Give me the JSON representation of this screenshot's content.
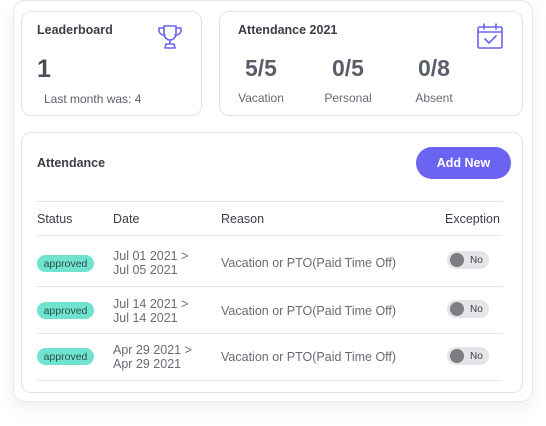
{
  "leaderboard": {
    "title": "Leaderboard",
    "icon": "trophy-icon",
    "rank": "1",
    "last_month": "Last month was: 4"
  },
  "attendance_summary": {
    "title": "Attendance 2021",
    "icon": "calendar-check-icon",
    "stats": [
      {
        "value": "5/5",
        "label": "Vacation"
      },
      {
        "value": "0/5",
        "label": "Personal"
      },
      {
        "value": "0/8",
        "label": "Absent"
      }
    ]
  },
  "attendance_table": {
    "title": "Attendance",
    "add_button": "Add New",
    "columns": [
      "Status",
      "Date",
      "Reason",
      "Exception"
    ],
    "rows": [
      {
        "status": "approved",
        "date_start": "Jul 01 2021 >",
        "date_end": "Jul 05 2021",
        "reason": "Vacation or PTO(Paid Time Off)",
        "exception": "No"
      },
      {
        "status": "approved",
        "date_start": "Jul 14 2021 >",
        "date_end": "Jul 14 2021",
        "reason": "Vacation or PTO(Paid Time Off)",
        "exception": "No"
      },
      {
        "status": "approved",
        "date_start": "Apr 29 2021 >",
        "date_end": "Apr 29 2021",
        "reason": "Vacation or PTO(Paid Time Off)",
        "exception": "No"
      }
    ]
  },
  "colors": {
    "accent": "#6b63f2",
    "approved_badge": "#6fe3cf",
    "icon_purple": "#6b63f2"
  }
}
